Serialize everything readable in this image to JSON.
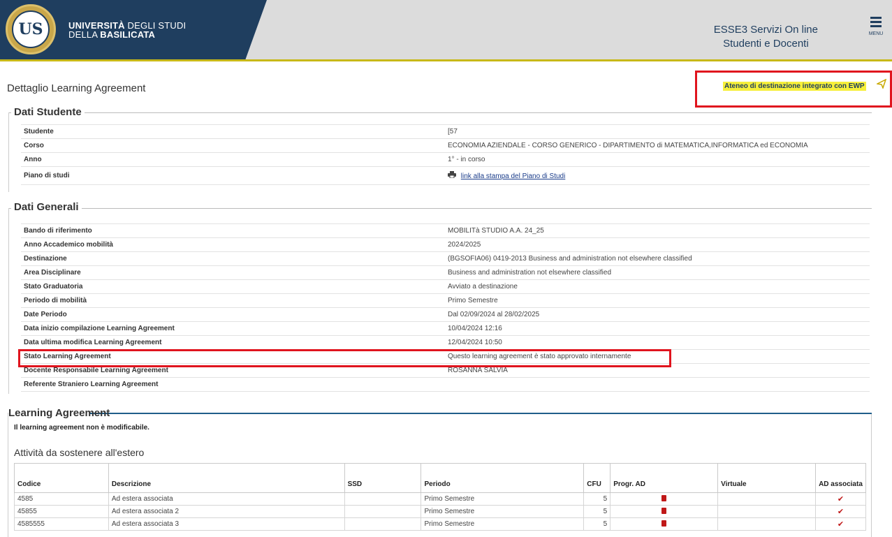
{
  "header": {
    "university_line1_bold": "UNIVERSITÀ",
    "university_line1_rest": " DEGLI STUDI",
    "university_line2_prefix": "DELLA ",
    "university_line2_bold": "BASILICATA",
    "seal_letters": "US",
    "service_line1": "ESSE3 Servizi On line",
    "service_line2": "Studenti e Docenti",
    "menu_label": "MENU"
  },
  "page": {
    "title": "Dettaglio Learning Agreement",
    "ewp_link": "Ateneo di destinazione integrato con EWP"
  },
  "dati_studente": {
    "legend": "Dati Studente",
    "rows": [
      {
        "label": "Studente",
        "value": "[57"
      },
      {
        "label": "Corso",
        "value": "ECONOMIA AZIENDALE - CORSO GENERICO - DIPARTIMENTO di MATEMATICA,INFORMATICA ed ECONOMIA"
      },
      {
        "label": "Anno",
        "value": "1° - in corso"
      },
      {
        "label": "Piano di studi",
        "value": "link alla stampa del Piano di Studi"
      }
    ]
  },
  "dati_generali": {
    "legend": "Dati Generali",
    "rows": [
      {
        "label": "Bando di riferimento",
        "value": "MOBILITà STUDIO A.A. 24_25"
      },
      {
        "label": "Anno Accademico mobilità",
        "value": "2024/2025"
      },
      {
        "label": "Destinazione",
        "value": "(BGSOFIA06) 0419-2013 Business and administration not elsewhere classified"
      },
      {
        "label": "Area Disciplinare",
        "value": "Business and administration not elsewhere classified"
      },
      {
        "label": "Stato Graduatoria",
        "value": "Avviato a destinazione"
      },
      {
        "label": "Periodo di mobilità",
        "value": "Primo Semestre"
      },
      {
        "label": "Date Periodo",
        "value": "Dal 02/09/2024 al 28/02/2025"
      },
      {
        "label": "Data inizio compilazione Learning Agreement",
        "value": "10/04/2024 12:16"
      },
      {
        "label": "Data ultima modifica Learning Agreement",
        "value": "12/04/2024 10:50"
      },
      {
        "label": "Stato Learning Agreement",
        "value": "Questo learning agreement è stato approvato internamente"
      },
      {
        "label": "Docente Responsabile Learning Agreement",
        "value": "ROSANNA SALVIA"
      },
      {
        "label": "Referente Straniero Learning Agreement",
        "value": ""
      }
    ]
  },
  "learning_agreement": {
    "legend": "Learning Agreement",
    "note": "Il learning agreement non è modificabile.",
    "subtitle": "Attività da sostenere all'estero",
    "columns": [
      "Codice",
      "Descrizione",
      "SSD",
      "Periodo",
      "CFU",
      "Progr. AD",
      "Virtuale",
      "AD associata"
    ],
    "rows": [
      {
        "codice": "4585",
        "descrizione": "Ad estera associata",
        "ssd": "",
        "periodo": "Primo Semestre",
        "cfu": "5",
        "virtuale": ""
      },
      {
        "codice": "45855",
        "descrizione": "Ad estera associata 2",
        "ssd": "",
        "periodo": "Primo Semestre",
        "cfu": "5",
        "virtuale": ""
      },
      {
        "codice": "4585555",
        "descrizione": "Ad estera associata 3",
        "ssd": "",
        "periodo": "Primo Semestre",
        "cfu": "5",
        "virtuale": ""
      }
    ]
  }
}
